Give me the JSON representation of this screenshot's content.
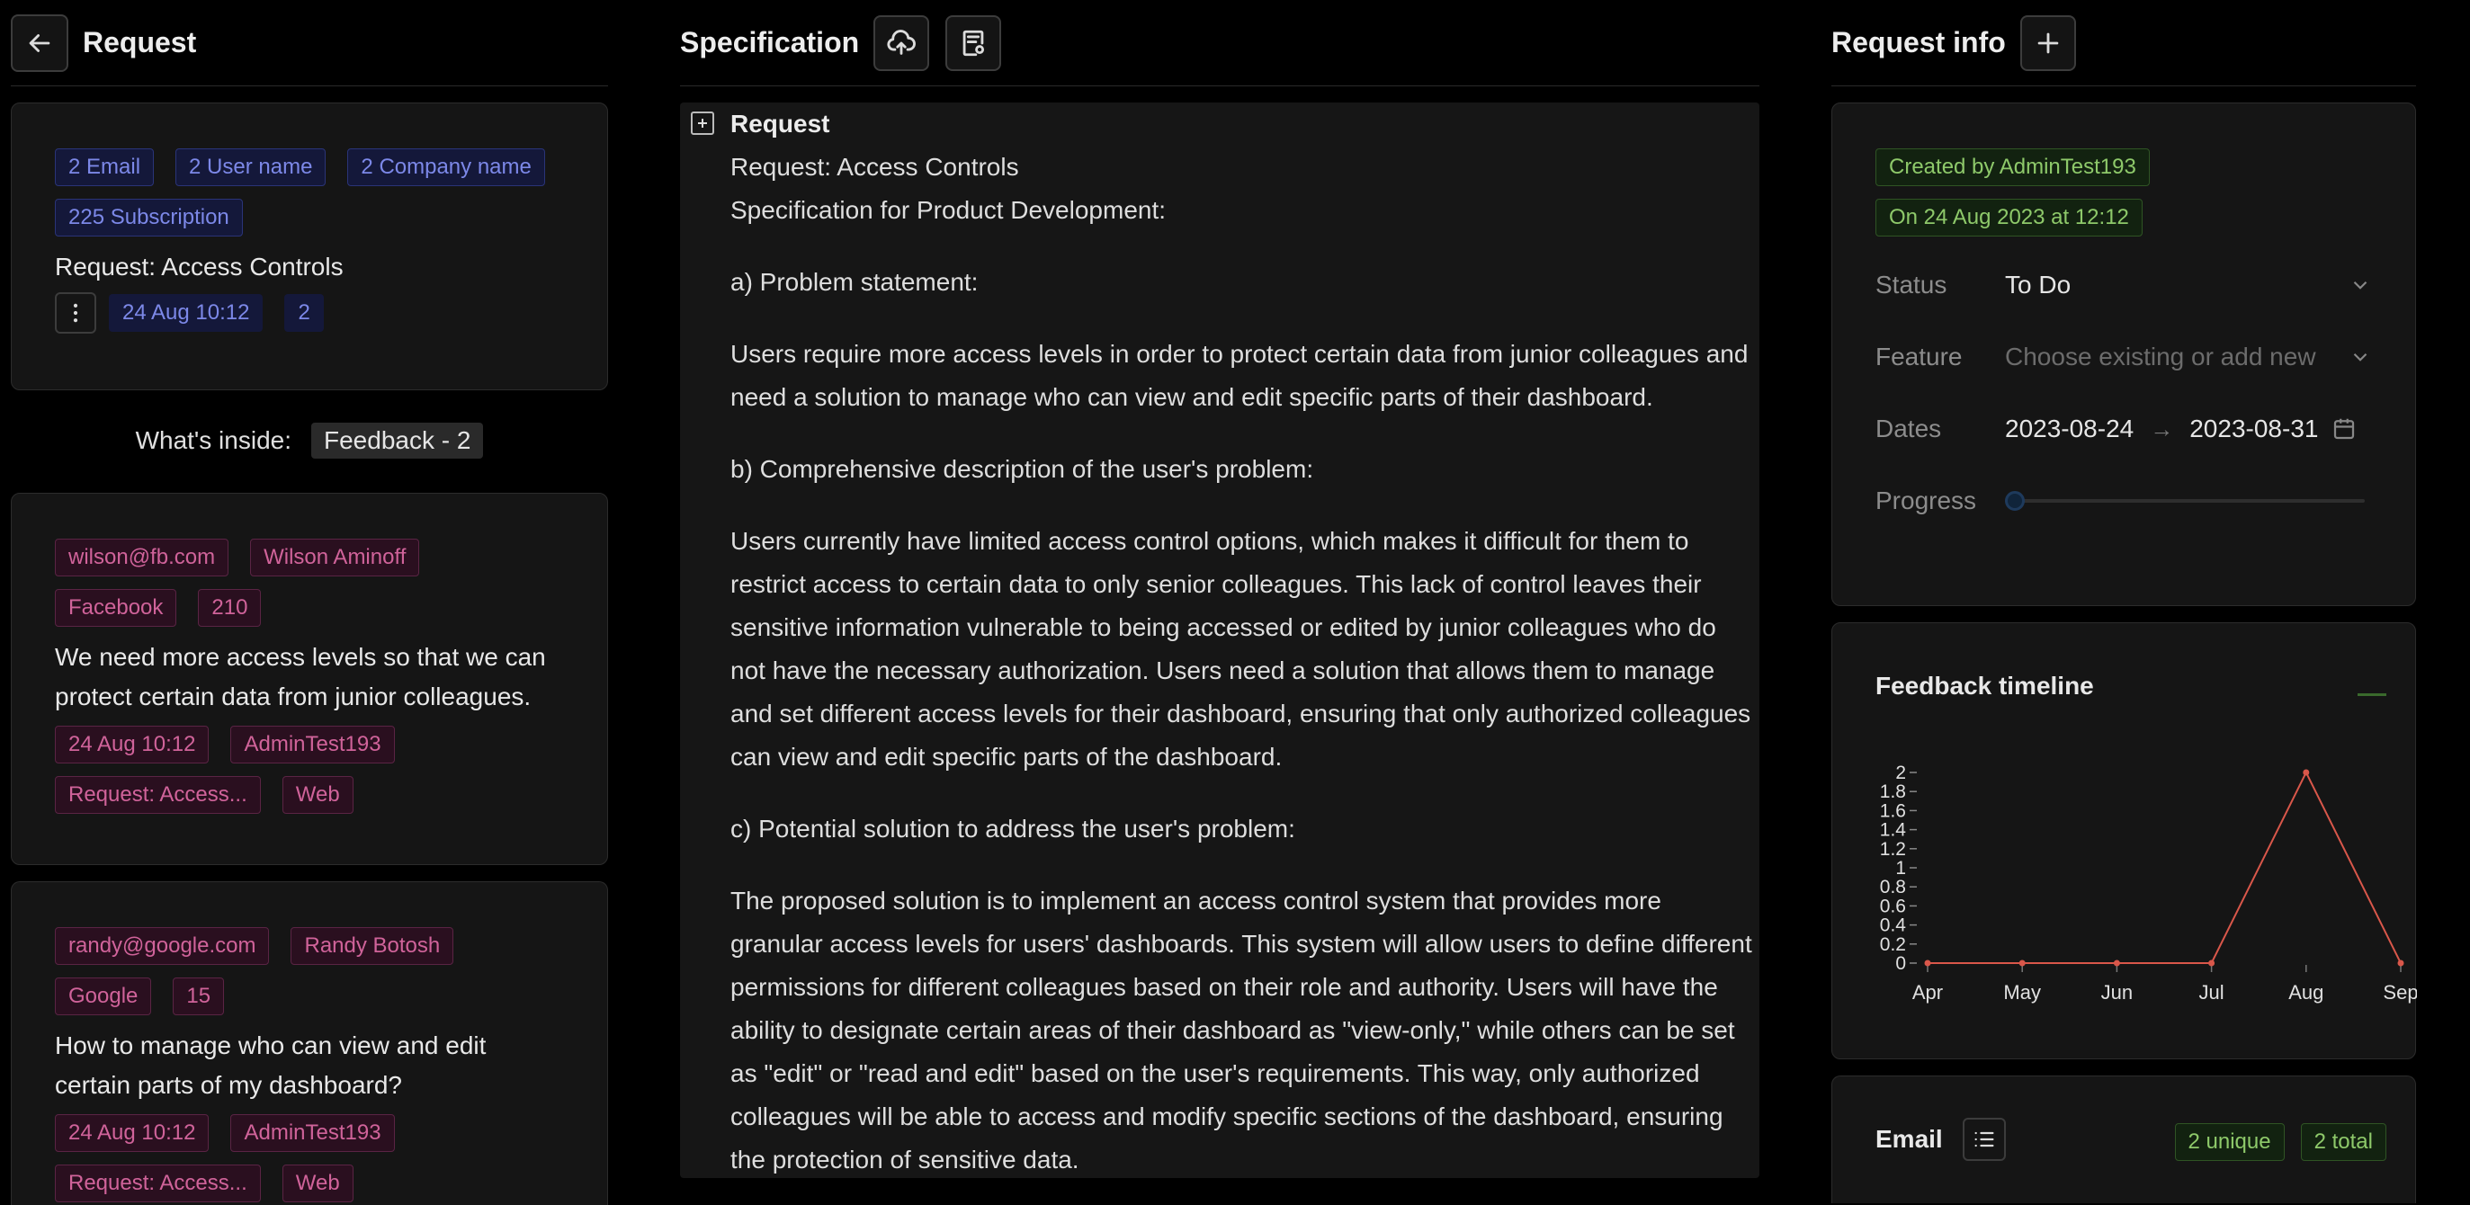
{
  "left": {
    "title": "Request",
    "request_card": {
      "tags": [
        "2 Email",
        "2 User name",
        "2 Company name",
        "225 Subscription"
      ],
      "title": "Request: Access Controls",
      "date": "24 Aug 10:12",
      "count": "2"
    },
    "inside_label": "What's inside:",
    "inside_value": "Feedback - 2",
    "feedback": [
      {
        "email": "wilson@fb.com",
        "name": "Wilson Aminoff",
        "company": "Facebook",
        "subscription": "210",
        "text": "We need more access levels so that we can protect certain data from junior colleagues.",
        "date": "24 Aug 10:12",
        "author": "AdminTest193",
        "request": "Request: Access...",
        "source": "Web"
      },
      {
        "email": "randy@google.com",
        "name": "Randy Botosh",
        "company": "Google",
        "subscription": "15",
        "text": "How to manage who can view and edit certain parts of my dashboard?",
        "date": "24 Aug 10:12",
        "author": "AdminTest193",
        "request": "Request: Access...",
        "source": "Web"
      }
    ]
  },
  "middle": {
    "title": "Specification",
    "section_title": "Request",
    "lines": {
      "l1": "Request: Access Controls",
      "l2": "Specification for Product Development:",
      "a": "a) Problem statement:",
      "a_text": "Users require more access levels in order to protect certain data from junior colleagues and need a solution to manage who can view and edit specific parts of their dashboard.",
      "b": "b) Comprehensive description of the user's problem:",
      "b_text": "Users currently have limited access control options, which makes it difficult for them to restrict access to certain data to only senior colleagues. This lack of control leaves their sensitive information vulnerable to being accessed or edited by junior colleagues who do not have the necessary authorization. Users need a solution that allows them to manage and set different access levels for their dashboard, ensuring that only authorized colleagues can view and edit specific parts of the dashboard.",
      "c": "c) Potential solution to address the user's problem:",
      "c_text": "The proposed solution is to implement an access control system that provides more granular access levels for users' dashboards. This system will allow users to define different permissions for different colleagues based on their role and authority. Users will have the ability to designate certain areas of their dashboard as \"view-only,\" while others can be set as \"edit\" or \"read and edit\" based on the user's requirements. This way, only authorized colleagues will be able to access and modify specific sections of the dashboard, ensuring the protection of sensitive data."
    }
  },
  "right": {
    "title": "Request info",
    "created_by": "Created by AdminTest193",
    "created_on": "On 24 Aug 2023 at 12:12",
    "status_label": "Status",
    "status_value": "To Do",
    "feature_label": "Feature",
    "feature_placeholder": "Choose existing or add new",
    "dates_label": "Dates",
    "date_start": "2023-08-24",
    "date_arrow": "→",
    "date_end": "2023-08-31",
    "progress_label": "Progress",
    "progress_value": 0,
    "timeline_title": "Feedback timeline",
    "email_title": "Email",
    "email_unique": "2 unique",
    "email_total": "2 total"
  },
  "colors": {
    "line": "#d9574a",
    "blue_tag": "#7c88e8",
    "pink_tag": "#d0639a",
    "green_tag": "#8ec96a"
  },
  "chart_data": {
    "type": "line",
    "categories": [
      "Apr",
      "May",
      "Jun",
      "Jul",
      "Aug",
      "Sep"
    ],
    "values": [
      0,
      0,
      0,
      0,
      2,
      0
    ],
    "y_ticks": [
      "0",
      "0.2",
      "0.4",
      "0.6",
      "0.8",
      "1",
      "1.2",
      "1.4",
      "1.6",
      "1.8",
      "2"
    ],
    "ylim": [
      0,
      2
    ],
    "title": "Feedback timeline",
    "xlabel": "",
    "ylabel": "",
    "grid": false
  }
}
